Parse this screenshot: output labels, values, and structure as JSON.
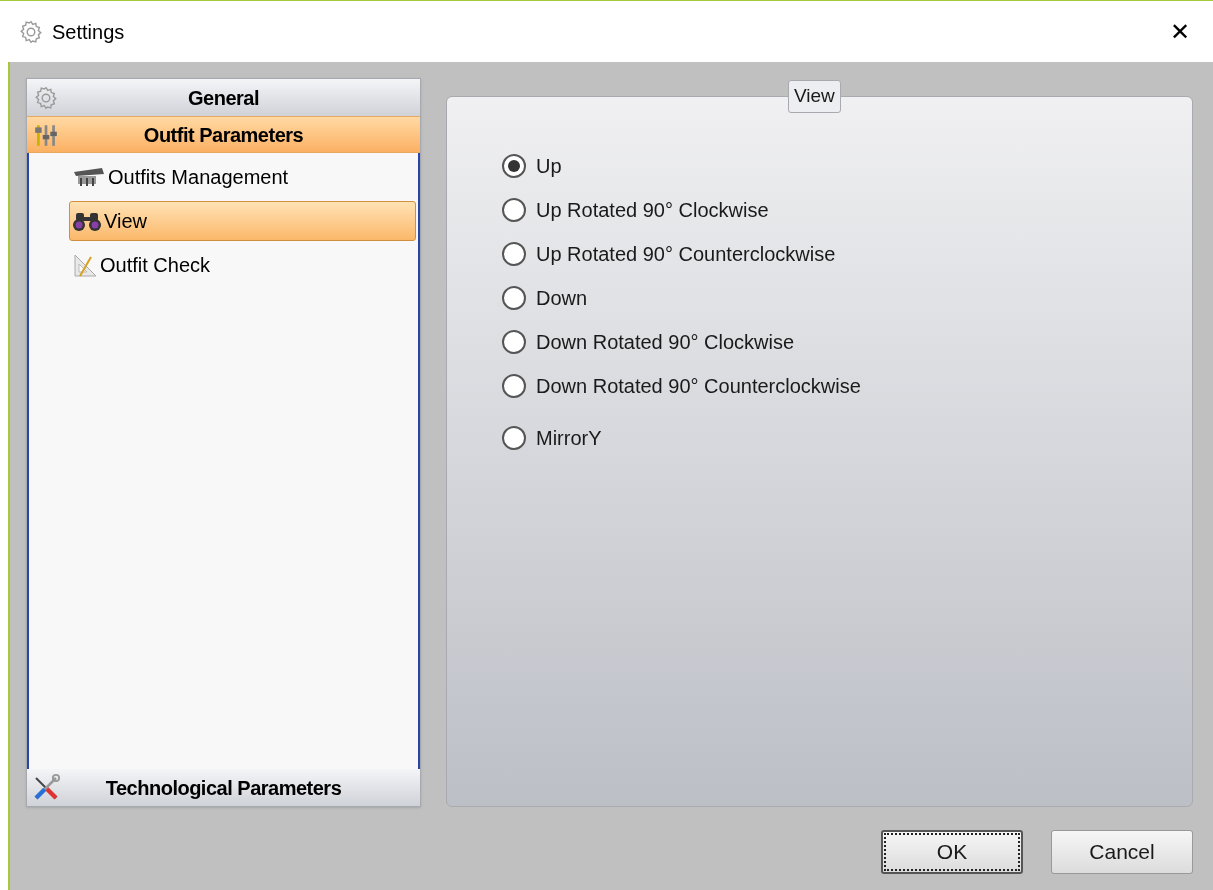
{
  "window": {
    "title": "Settings",
    "close": "✕"
  },
  "sidebar": {
    "groups": [
      {
        "label": "General",
        "selected": false,
        "expanded": false
      },
      {
        "label": "Outfit Parameters",
        "selected": true,
        "expanded": true,
        "items": [
          {
            "label": "Outfits Management",
            "selected": false
          },
          {
            "label": "View",
            "selected": true
          },
          {
            "label": "Outfit Check",
            "selected": false
          }
        ]
      },
      {
        "label": "Technological Parameters",
        "selected": false,
        "expanded": false
      }
    ]
  },
  "view_group": {
    "title": "View",
    "options": [
      {
        "label": "Up",
        "selected": true
      },
      {
        "label": "Up Rotated 90° Clockwise",
        "selected": false
      },
      {
        "label": "Up Rotated 90° Counterclockwise",
        "selected": false
      },
      {
        "label": "Down",
        "selected": false
      },
      {
        "label": "Down Rotated 90° Clockwise",
        "selected": false
      },
      {
        "label": "Down Rotated 90° Counterclockwise",
        "selected": false
      },
      {
        "label": "MirrorY",
        "selected": false
      }
    ]
  },
  "buttons": [
    {
      "label": "OK",
      "default": true
    },
    {
      "label": "Cancel",
      "default": false
    }
  ]
}
